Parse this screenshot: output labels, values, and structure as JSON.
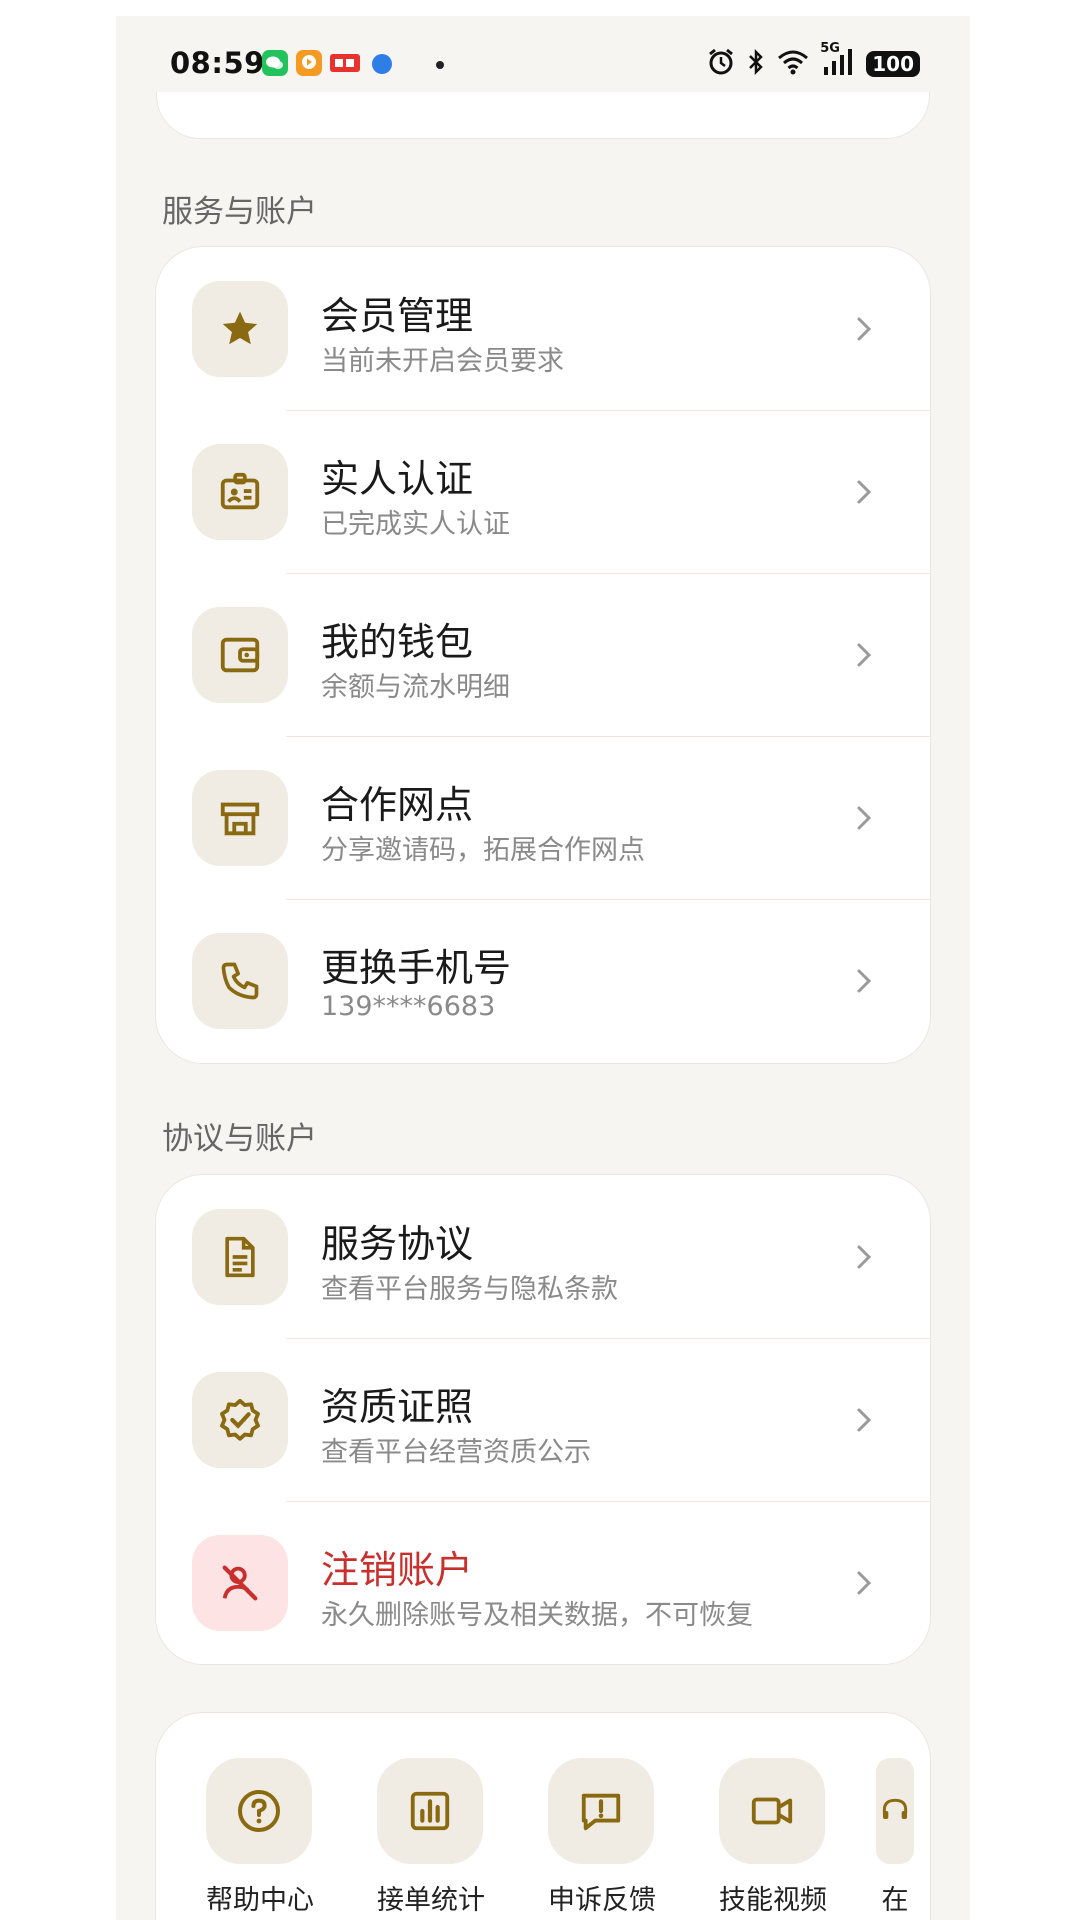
{
  "status_bar": {
    "time": "08:59",
    "network": "5G",
    "battery": "100",
    "icons": [
      "wechat-icon",
      "video-app-icon",
      "toutiao-icon",
      "browser-icon",
      "alarm-icon",
      "bluetooth-icon",
      "wifi-icon",
      "signal-icon"
    ]
  },
  "sections": [
    {
      "title": "服务与账户",
      "items": [
        {
          "icon": "star-icon",
          "title": "会员管理",
          "subtitle": "当前未开启会员要求"
        },
        {
          "icon": "id-card-icon",
          "title": "实人认证",
          "subtitle": "已完成实人认证"
        },
        {
          "icon": "wallet-icon",
          "title": "我的钱包",
          "subtitle": "余额与流水明细"
        },
        {
          "icon": "store-icon",
          "title": "合作网点",
          "subtitle": "分享邀请码，拓展合作网点"
        },
        {
          "icon": "phone-icon",
          "title": "更换手机号",
          "subtitle": "139****6683"
        }
      ]
    },
    {
      "title": "协议与账户",
      "items": [
        {
          "icon": "document-icon",
          "title": "服务协议",
          "subtitle": "查看平台服务与隐私条款"
        },
        {
          "icon": "verified-badge-icon",
          "title": "资质证照",
          "subtitle": "查看平台经营资质公示"
        },
        {
          "icon": "user-off-icon",
          "title": "注销账户",
          "subtitle": "永久删除账号及相关数据，不可恢复"
        }
      ]
    }
  ],
  "quick_actions": [
    {
      "icon": "help-icon",
      "label": "帮助中心"
    },
    {
      "icon": "stats-icon",
      "label": "接单统计"
    },
    {
      "icon": "feedback-icon",
      "label": "申诉反馈"
    },
    {
      "icon": "video-icon",
      "label": "技能视频"
    },
    {
      "icon": "headset-icon",
      "label": "在"
    }
  ],
  "colors": {
    "accent": "#8a6a10",
    "danger": "#c8302d",
    "icon_bg": "#f0ebe3",
    "danger_bg": "#fde3e3",
    "page_bg": "#f7f5f1"
  }
}
